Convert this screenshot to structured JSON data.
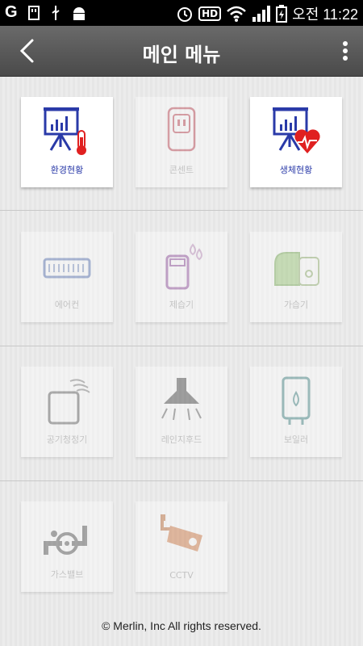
{
  "statusbar": {
    "carrier_icon": "G",
    "time": "오전 11:22",
    "hd_label": "HD"
  },
  "appbar": {
    "title": "메인 메뉴"
  },
  "tiles": [
    {
      "label": "환경현황",
      "icon": "env-status-icon",
      "enabled": true
    },
    {
      "label": "콘센트",
      "icon": "outlet-icon",
      "enabled": false
    },
    {
      "label": "생체현황",
      "icon": "bio-status-icon",
      "enabled": true
    },
    {
      "label": "에어컨",
      "icon": "air-conditioner-icon",
      "enabled": false
    },
    {
      "label": "제습기",
      "icon": "dehumidifier-icon",
      "enabled": false
    },
    {
      "label": "가습기",
      "icon": "humidifier-icon",
      "enabled": false
    },
    {
      "label": "공기청정기",
      "icon": "air-purifier-icon",
      "enabled": false
    },
    {
      "label": "레인지후드",
      "icon": "range-hood-icon",
      "enabled": false
    },
    {
      "label": "보일러",
      "icon": "boiler-icon",
      "enabled": false
    },
    {
      "label": "가스밸브",
      "icon": "gas-valve-icon",
      "enabled": false
    },
    {
      "label": "CCTV",
      "icon": "cctv-icon",
      "enabled": false
    }
  ],
  "footer": {
    "copyright": "© Merlin, Inc All rights reserved."
  },
  "colors": {
    "accent_blue": "#2a3aa8",
    "heart_red": "#e02020",
    "appbar": "#5a5a5a"
  }
}
